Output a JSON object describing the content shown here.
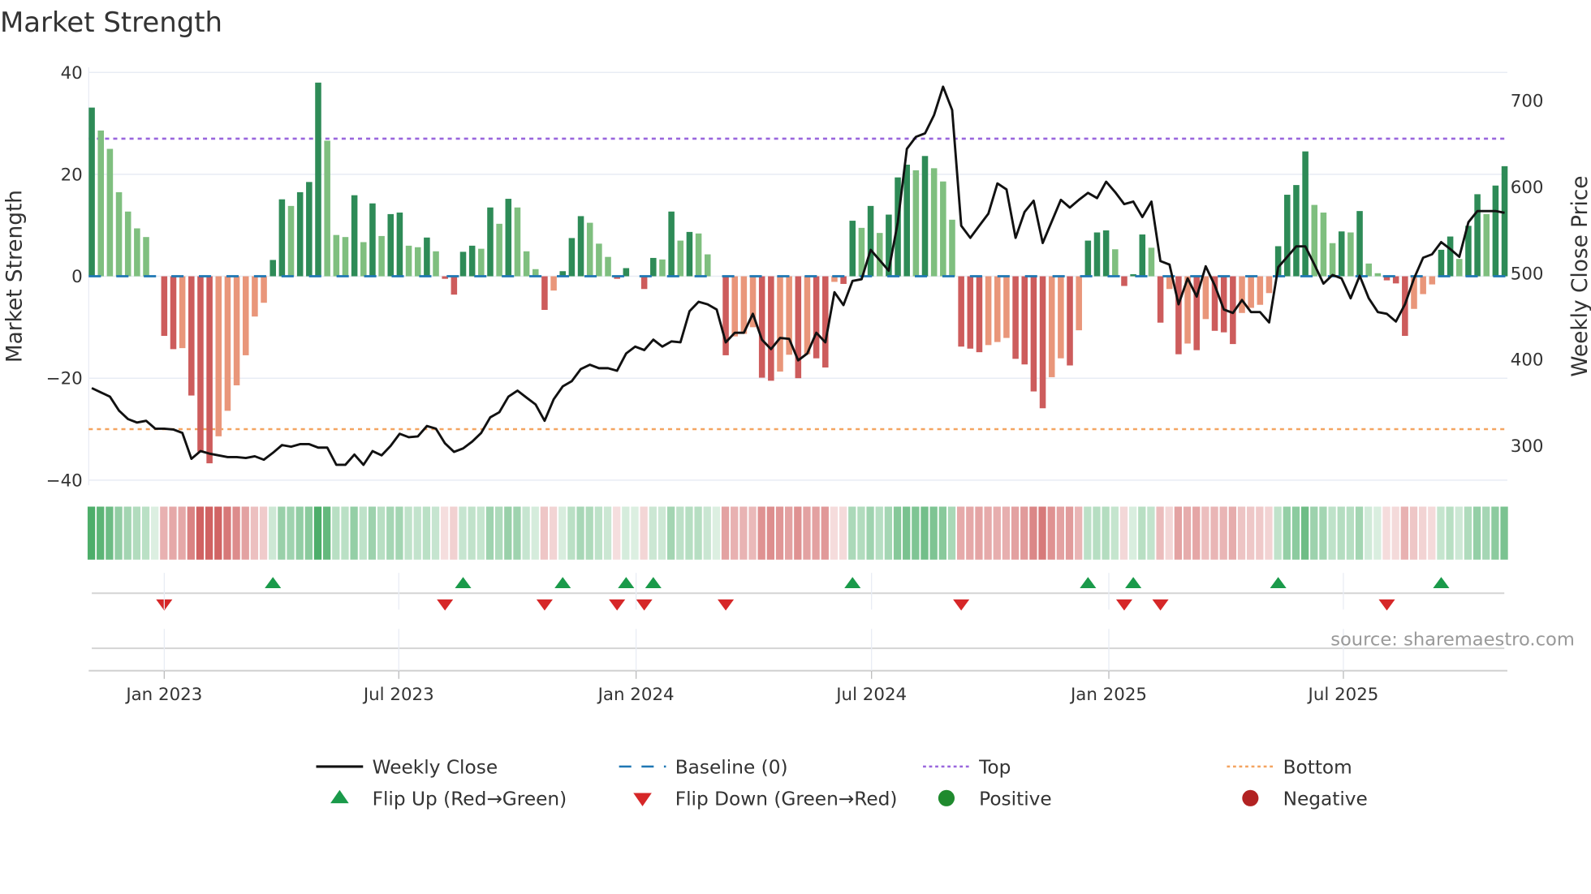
{
  "title": "Market Strength",
  "source": "source: sharemaestro.com",
  "colors": {
    "pos_strong": "#2e8b57",
    "pos_weak": "#7fbf7f",
    "neg_strong": "#cd5c5c",
    "neg_weak": "#e9967a",
    "price_line": "#111111",
    "baseline": "#1f77b4",
    "top": "#9966dd",
    "bottom": "#f4a460",
    "flip_up": "#1a9a4a",
    "flip_down": "#d62728",
    "grid": "#e8ecf4"
  },
  "chart_data": {
    "type": "bar+line",
    "title": "Market Strength",
    "ylabel": "Market Strength",
    "y2label": "Weekly Close Price",
    "ylim": [
      -42,
      42
    ],
    "y2lim": [
      250,
      745
    ],
    "yticks": [
      40,
      20,
      0,
      -20,
      -40
    ],
    "ytick_labels": [
      "40",
      "20",
      "0",
      "−20",
      "−40"
    ],
    "y2ticks": [
      700,
      600,
      500,
      400,
      300
    ],
    "y2tick_labels": [
      "700",
      "600",
      "500",
      "400",
      "300"
    ],
    "xticks": [
      {
        "week": 8,
        "label": "Jan 2023"
      },
      {
        "week": 33.9,
        "label": "Jul 2023"
      },
      {
        "week": 60.1,
        "label": "Jan 2024"
      },
      {
        "week": 86.1,
        "label": "Jul 2024"
      },
      {
        "week": 112.3,
        "label": "Jan 2025"
      },
      {
        "week": 138.2,
        "label": "Jul 2025"
      }
    ],
    "x_start": "2022-11-06",
    "x_interval": "weekly",
    "top_level": 27,
    "bottom_level": -30,
    "baseline_level": 0,
    "strength": [
      33.1,
      28.6,
      25,
      16.5,
      12.7,
      9.4,
      7.7,
      0,
      -11.7,
      -14.3,
      -14.1,
      -23.4,
      -34.4,
      -36.7,
      -31.4,
      -26.4,
      -21.4,
      -15.5,
      -7.9,
      -5.2,
      3.2,
      15.1,
      13.8,
      16.5,
      18.5,
      38,
      26.6,
      8.1,
      7.7,
      15.9,
      6.7,
      14.3,
      7.9,
      12.2,
      12.5,
      6,
      5.7,
      7.6,
      4.9,
      -0.5,
      -3.6,
      4.8,
      6,
      5.4,
      13.5,
      10.3,
      15.2,
      13.5,
      4.9,
      1.4,
      -6.6,
      -2.8,
      1,
      7.5,
      11.8,
      10.5,
      6.4,
      3.8,
      -0.5,
      1.6,
      0,
      -2.5,
      3.6,
      3.3,
      12.7,
      7,
      8.7,
      8.4,
      4.3,
      0,
      -15.5,
      -11.8,
      -11.3,
      -10,
      -19.9,
      -20.5,
      -18.7,
      -15.4,
      -20,
      -15.3,
      -16.1,
      -17.9,
      -1.1,
      -1.5,
      10.9,
      9.5,
      13.8,
      8.5,
      12.1,
      19.4,
      21.9,
      20.8,
      23.6,
      21.2,
      18.6,
      11.1,
      -13.8,
      -14.2,
      -14.9,
      -13.5,
      -12.9,
      -12.1,
      -16.2,
      -17.3,
      -22.6,
      -25.9,
      -19.8,
      -16.1,
      -17.5,
      -10.6,
      7,
      8.6,
      9,
      5.3,
      -1.9,
      0.4,
      8.2,
      5.6,
      -9.1,
      -2.5,
      -15.3,
      -13.2,
      -14.5,
      -8.4,
      -10.7,
      -11,
      -13.3,
      -7.2,
      -6.2,
      -5.6,
      -3.3,
      5.9,
      16,
      17.9,
      24.5,
      14,
      12.5,
      6.5,
      8.8,
      8.6,
      12.8,
      2.5,
      0.6,
      -0.8,
      -1.4,
      -11.7,
      -6.4,
      -3.5,
      -1.6,
      5.2,
      7.8,
      3.4,
      9.9,
      16.1,
      12.2,
      17.8,
      21.6
    ],
    "weekly_close": [
      367,
      362,
      357,
      341,
      331,
      327,
      329,
      320,
      320,
      319,
      315,
      285,
      294,
      291,
      289,
      287,
      287,
      286,
      288,
      284,
      292,
      301,
      299,
      302,
      302,
      298,
      298,
      278,
      278,
      290,
      278,
      294,
      289,
      300,
      314,
      310,
      311,
      323,
      320,
      303,
      293,
      297,
      305,
      315,
      333,
      339,
      357,
      364,
      356,
      348,
      329,
      354,
      369,
      375,
      389,
      394,
      390,
      390,
      387,
      407,
      415,
      411,
      423,
      415,
      421,
      420,
      456,
      467,
      464,
      458,
      420,
      431,
      431,
      453,
      423,
      412,
      425,
      424,
      399,
      407,
      431,
      420,
      478,
      463,
      491,
      493,
      527,
      515,
      503,
      559,
      644,
      658,
      662,
      683,
      716,
      689,
      555,
      541,
      555,
      569,
      604,
      597,
      541,
      571,
      584,
      535,
      560,
      585,
      576,
      585,
      593,
      587,
      606,
      594,
      580,
      583,
      565,
      583,
      514,
      510,
      464,
      494,
      473,
      508,
      486,
      458,
      454,
      469,
      455,
      455,
      443,
      507,
      519,
      531,
      531,
      510,
      488,
      498,
      494,
      471,
      497,
      471,
      455,
      453,
      444,
      464,
      494,
      518,
      522,
      536,
      528,
      519,
      559,
      572,
      572,
      572,
      570
    ],
    "flip_up_weeks": [
      21,
      42,
      53,
      60,
      63,
      85,
      111,
      116,
      132,
      150
    ],
    "flip_down_weeks": [
      9,
      40,
      51,
      59,
      62,
      71,
      97,
      115,
      119,
      144
    ],
    "legend": [
      {
        "key": "weekly_close",
        "label": "Weekly Close"
      },
      {
        "key": "baseline",
        "label": "Baseline (0)"
      },
      {
        "key": "top",
        "label": "Top"
      },
      {
        "key": "bottom",
        "label": "Bottom"
      },
      {
        "key": "flip_up",
        "label": "Flip Up (Red→Green)"
      },
      {
        "key": "flip_down",
        "label": "Flip Down (Green→Red)"
      },
      {
        "key": "positive",
        "label": "Positive"
      },
      {
        "key": "negative",
        "label": "Negative"
      }
    ],
    "legend_position": "bottom",
    "grid": true
  }
}
